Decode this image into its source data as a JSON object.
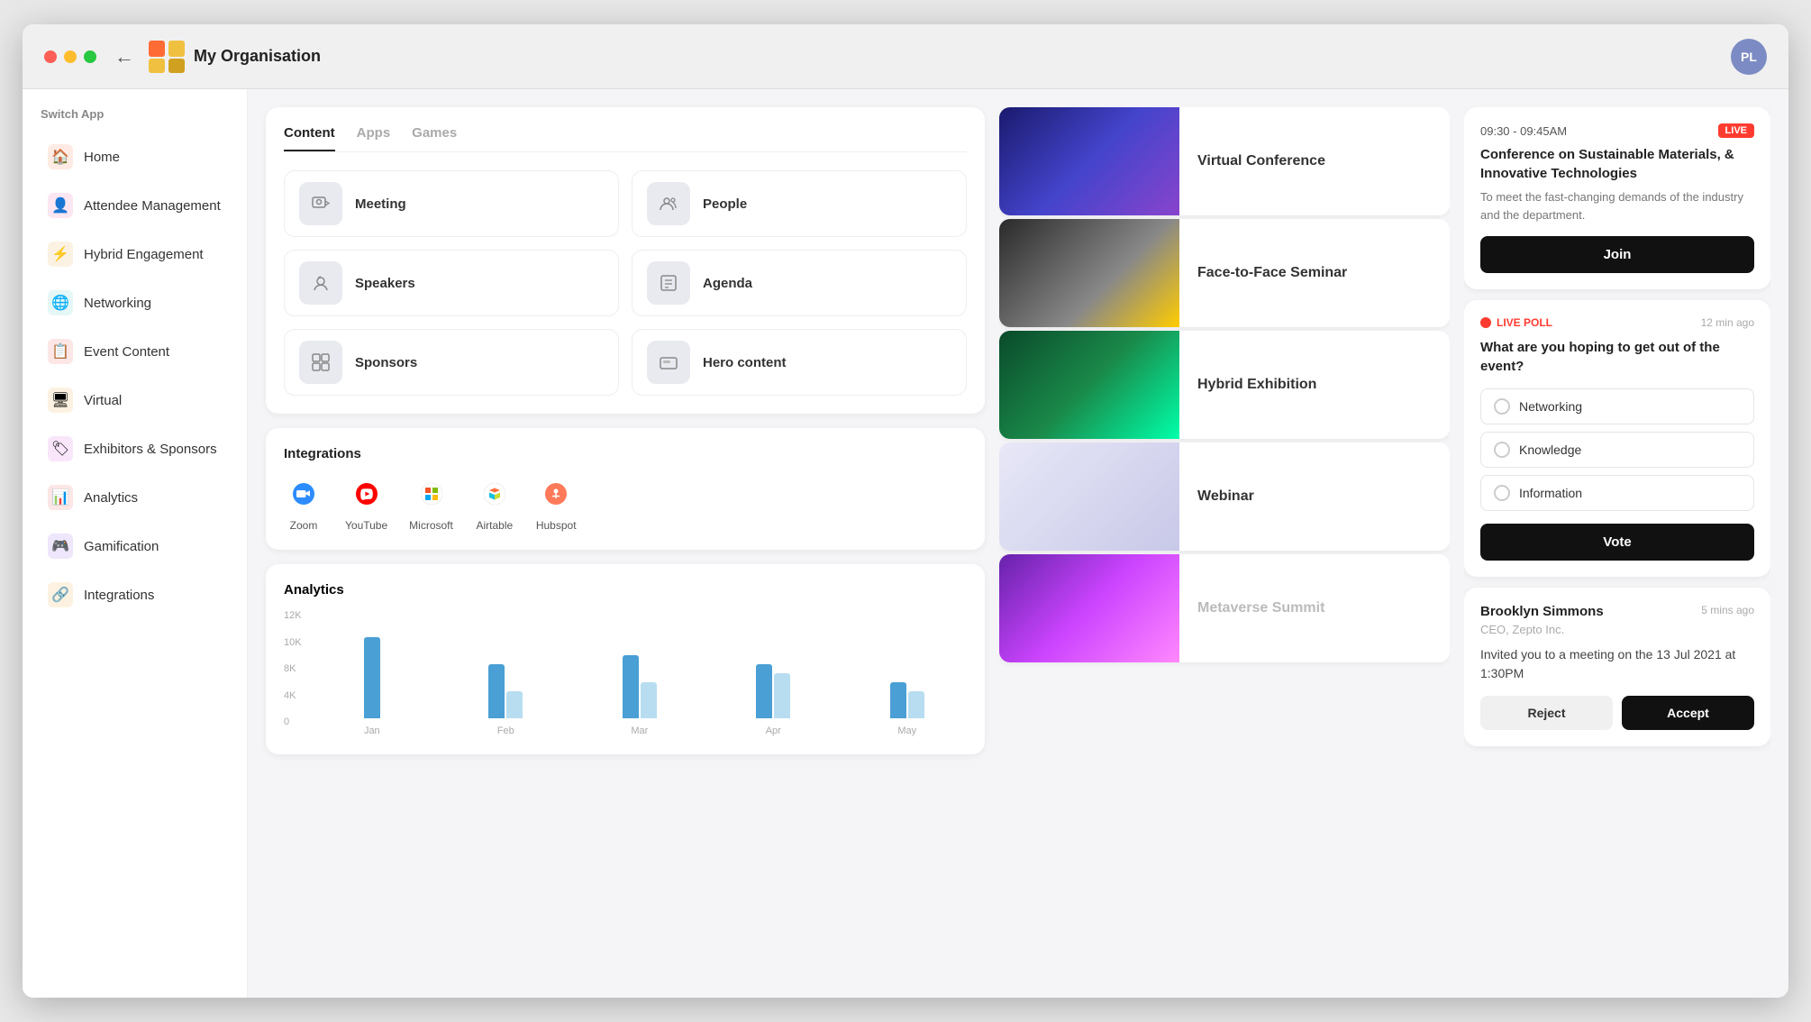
{
  "titlebar": {
    "back_label": "←",
    "title": "My Organisation",
    "avatar_initials": "PL"
  },
  "sidebar": {
    "switch_label": "Switch App",
    "items": [
      {
        "id": "home",
        "label": "Home",
        "icon": "🏠",
        "color": "#ff6b35"
      },
      {
        "id": "attendee-management",
        "label": "Attendee Management",
        "icon": "👤",
        "color": "#e84393"
      },
      {
        "id": "hybrid-engagement",
        "label": "Hybrid Engagement",
        "icon": "⚡",
        "color": "#e8a030"
      },
      {
        "id": "networking",
        "label": "Networking",
        "icon": "🌐",
        "color": "#3bc0c0"
      },
      {
        "id": "event-content",
        "label": "Event Content",
        "icon": "📋",
        "color": "#e84040"
      },
      {
        "id": "virtual",
        "label": "Virtual",
        "icon": "🖥",
        "color": "#f0a020"
      },
      {
        "id": "exhibitors-sponsors",
        "label": "Exhibitors & Sponsors",
        "icon": "🏷",
        "color": "#d040e0"
      },
      {
        "id": "analytics",
        "label": "Analytics",
        "icon": "📊",
        "color": "#e84040"
      },
      {
        "id": "gamification",
        "label": "Gamification",
        "icon": "🎮",
        "color": "#8040e0"
      },
      {
        "id": "integrations",
        "label": "Integrations",
        "icon": "🔗",
        "color": "#f0a020"
      }
    ]
  },
  "content_tabs": {
    "tabs": [
      {
        "id": "content",
        "label": "Content",
        "active": true
      },
      {
        "id": "apps",
        "label": "Apps",
        "active": false
      },
      {
        "id": "games",
        "label": "Games",
        "active": false
      }
    ],
    "items": [
      {
        "id": "meeting",
        "label": "Meeting",
        "icon": "👥"
      },
      {
        "id": "people",
        "label": "People",
        "icon": "👤"
      },
      {
        "id": "speakers",
        "label": "Speakers",
        "icon": "🎧"
      },
      {
        "id": "agenda",
        "label": "Agenda",
        "icon": "☰"
      },
      {
        "id": "sponsors",
        "label": "Sponsors",
        "icon": "⊞"
      },
      {
        "id": "hero-content",
        "label": "Hero content",
        "icon": "▬"
      }
    ]
  },
  "integrations": {
    "title": "Integrations",
    "items": [
      {
        "id": "zoom",
        "label": "Zoom",
        "icon": "zoom",
        "bg": "#2d8cff"
      },
      {
        "id": "youtube",
        "label": "YouTube",
        "icon": "youtube",
        "bg": "#ff0000"
      },
      {
        "id": "microsoft",
        "label": "Microsoft",
        "icon": "microsoft",
        "bg": "#fff"
      },
      {
        "id": "airtable",
        "label": "Airtable",
        "icon": "airtable",
        "bg": "#fff"
      },
      {
        "id": "hubspot",
        "label": "Hubspot",
        "icon": "hubspot",
        "bg": "#ff7a59"
      }
    ]
  },
  "analytics": {
    "title": "Analytics",
    "y_labels": [
      "12K",
      "10K",
      "8K",
      "4K",
      "0"
    ],
    "bars": [
      {
        "month": "Jan",
        "dark_h": 90,
        "light_h": 0
      },
      {
        "month": "Feb",
        "dark_h": 60,
        "light_h": 30
      },
      {
        "month": "Mar",
        "dark_h": 70,
        "light_h": 40
      },
      {
        "month": "Apr",
        "dark_h": 60,
        "light_h": 50
      },
      {
        "month": "May",
        "dark_h": 40,
        "light_h": 30
      }
    ]
  },
  "events": [
    {
      "id": "virtual-conference",
      "name": "Virtual Conference",
      "thumb_class": "thumb-vc",
      "muted": false
    },
    {
      "id": "face-to-face-seminar",
      "name": "Face-to-Face Seminar",
      "thumb_class": "thumb-f2f",
      "muted": false
    },
    {
      "id": "hybrid-exhibition",
      "name": "Hybrid Exhibition",
      "thumb_class": "thumb-he",
      "muted": false
    },
    {
      "id": "webinar",
      "name": "Webinar",
      "thumb_class": "thumb-wb",
      "muted": false
    },
    {
      "id": "metaverse-summit",
      "name": "Metaverse Summit",
      "thumb_class": "thumb-ms",
      "muted": true
    }
  ],
  "live_session": {
    "time": "09:30 - 09:45AM",
    "badge": "LIVE",
    "title": "Conference on Sustainable Materials, & Innovative Technologies",
    "description": "To meet the fast-changing demands of the industry and the department.",
    "join_label": "Join"
  },
  "live_poll": {
    "badge": "LIVE POLL",
    "time_ago": "12 min ago",
    "question": "What are you hoping to get out of the event?",
    "options": [
      {
        "id": "networking",
        "label": "Networking"
      },
      {
        "id": "knowledge",
        "label": "Knowledge"
      },
      {
        "id": "information",
        "label": "Information"
      }
    ],
    "vote_label": "Vote"
  },
  "meeting_invite": {
    "sender": "Brooklyn Simmons",
    "role": "CEO, Zepto Inc.",
    "time_ago": "5 mins ago",
    "message": "Invited you to a meeting on the 13 Jul 2021 at 1:30PM",
    "reject_label": "Reject",
    "accept_label": "Accept"
  }
}
